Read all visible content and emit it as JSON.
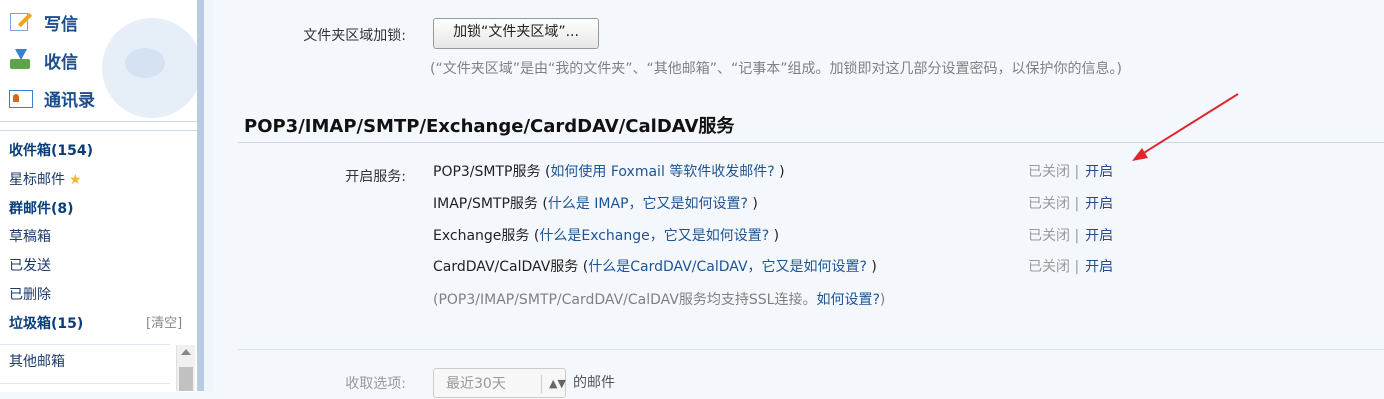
{
  "sidebar": {
    "top": {
      "compose": "写信",
      "inbox": "收信",
      "contacts": "通讯录"
    },
    "folders": {
      "inbox": "收件箱(154)",
      "starred": "星标邮件",
      "group": "群邮件(8)",
      "drafts": "草稿箱",
      "sent": "已发送",
      "deleted": "已删除",
      "spam": "垃圾箱(15)",
      "spam_clear": "[清空]",
      "other": "其他邮箱"
    }
  },
  "main": {
    "folder_lock": {
      "label": "文件夹区域加锁:",
      "button": "加锁“文件夹区域”...",
      "note": "(“文件夹区域”是由“我的文件夹”、“其他邮箱”、“记事本”组成。加锁即对这几部分设置密码，以保护你的信息。)"
    },
    "section_title": "POP3/IMAP/SMTP/Exchange/CardDAV/CalDAV服务",
    "enable_label": "开启服务:",
    "services": [
      {
        "name": "POP3/SMTP服务",
        "paren_open": " (",
        "link": "如何使用 Foxmail 等软件收发邮件?",
        "paren_close": " )",
        "status": "已关闭",
        "sep": "|",
        "action": "开启"
      },
      {
        "name": "IMAP/SMTP服务",
        "paren_open": " (",
        "link": "什么是 IMAP，它又是如何设置?",
        "paren_close": " )",
        "status": "已关闭",
        "sep": "|",
        "action": "开启"
      },
      {
        "name": "Exchange服务",
        "paren_open": " (",
        "link": "什么是Exchange，它又是如何设置?",
        "paren_close": " )",
        "status": "已关闭",
        "sep": "|",
        "action": "开启"
      },
      {
        "name": "CardDAV/CalDAV服务",
        "paren_open": " (",
        "link": "什么是CardDAV/CalDAV，它又是如何设置?",
        "paren_close": " )",
        "status": "已关闭",
        "sep": "|",
        "action": "开启"
      }
    ],
    "ssl_note_prefix": "(POP3/IMAP/SMTP/CardDAV/CalDAV服务均支持SSL连接。",
    "ssl_link": "如何设置?",
    "ssl_note_suffix": ")",
    "receive": {
      "label": "收取选项:",
      "selected": "最近30天",
      "suffix": "的邮件"
    }
  },
  "colors": {
    "annotation_arrow": "#e0262a",
    "link": "#1e5494"
  }
}
